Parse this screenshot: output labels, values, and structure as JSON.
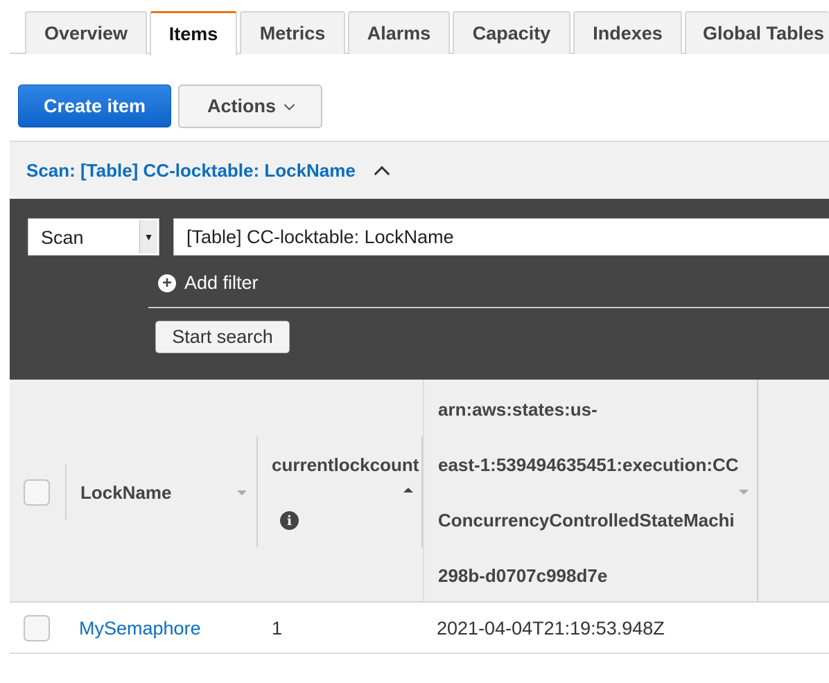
{
  "tabs": [
    {
      "label": "Overview",
      "active": false
    },
    {
      "label": "Items",
      "active": true
    },
    {
      "label": "Metrics",
      "active": false
    },
    {
      "label": "Alarms",
      "active": false
    },
    {
      "label": "Capacity",
      "active": false
    },
    {
      "label": "Indexes",
      "active": false
    },
    {
      "label": "Global Tables",
      "active": false
    }
  ],
  "toolbar": {
    "create_label": "Create item",
    "actions_label": "Actions"
  },
  "scan": {
    "header_title": "Scan: [Table] CC-locktable: LockName",
    "mode_value": "Scan",
    "table_value": "[Table] CC-locktable: LockName",
    "add_filter_label": "Add filter",
    "start_search_label": "Start search"
  },
  "table": {
    "columns": [
      {
        "label": "LockName"
      },
      {
        "label": "currentlockcount"
      },
      {
        "label_lines": [
          "arn:aws:states:us-",
          "east-1:539494635451:execution:CC",
          "ConcurrencyControlledStateMachi",
          "298b-d0707c998d7e"
        ]
      }
    ],
    "rows": [
      {
        "lockname": "MySemaphore",
        "currentlockcount": "1",
        "execution": "2021-04-04T21:19:53.948Z"
      }
    ]
  },
  "colors": {
    "accent_tab": "#ec7211",
    "primary_button": "#1f74d8",
    "link": "#0b6ebf",
    "panel": "#454545"
  }
}
